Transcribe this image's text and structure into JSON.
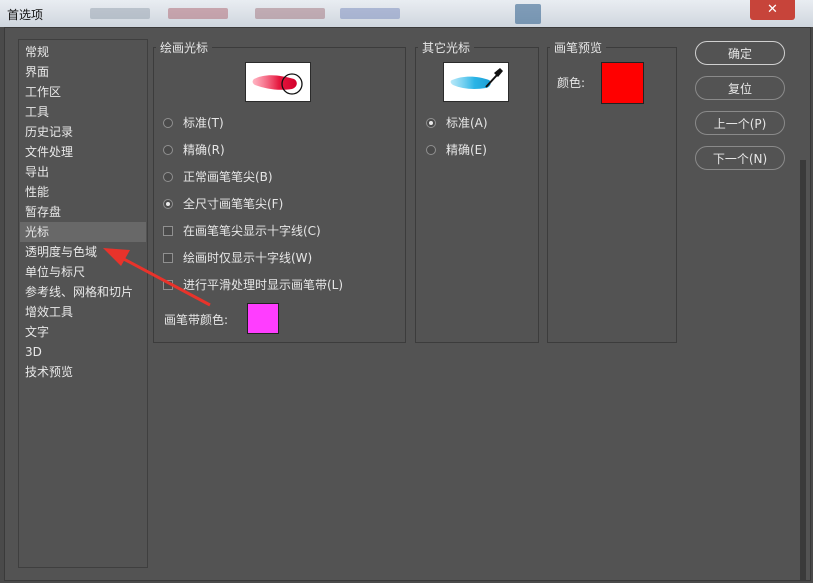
{
  "window": {
    "title": "首选项",
    "close_label": "✕"
  },
  "colors": {
    "stroke_color": "#ff3dff",
    "brush_preview_color": "#ff0000",
    "annotation_arrow": "#e8332b"
  },
  "categories": [
    {
      "label": "常规"
    },
    {
      "label": "界面"
    },
    {
      "label": "工作区"
    },
    {
      "label": "工具"
    },
    {
      "label": "历史记录"
    },
    {
      "label": "文件处理"
    },
    {
      "label": "导出"
    },
    {
      "label": "性能"
    },
    {
      "label": "暂存盘"
    },
    {
      "label": "光标"
    },
    {
      "label": "透明度与色域"
    },
    {
      "label": "单位与标尺"
    },
    {
      "label": "参考线、网格和切片"
    },
    {
      "label": "增效工具"
    },
    {
      "label": "文字"
    },
    {
      "label": "3D"
    },
    {
      "label": "技术预览"
    }
  ],
  "selected_category": "光标",
  "painting_cursors": {
    "title": "绘画光标",
    "options": [
      {
        "label": "标准(T)",
        "checked": false
      },
      {
        "label": "精确(R)",
        "checked": false
      },
      {
        "label": "正常画笔笔尖(B)",
        "checked": false
      },
      {
        "label": "全尺寸画笔笔尖(F)",
        "checked": true
      }
    ],
    "checkboxes": [
      {
        "label": "在画笔笔尖显示十字线(C)",
        "checked": false
      },
      {
        "label": "绘画时仅显示十字线(W)",
        "checked": false
      },
      {
        "label": "进行平滑处理时显示画笔带(L)",
        "checked": false
      }
    ],
    "stroke_color_label": "画笔带颜色:"
  },
  "other_cursors": {
    "title": "其它光标",
    "options": [
      {
        "label": "标准(A)",
        "checked": true
      },
      {
        "label": "精确(E)",
        "checked": false
      }
    ]
  },
  "brush_preview": {
    "title": "画笔预览",
    "color_label": "颜色:"
  },
  "buttons": {
    "ok": "确定",
    "reset": "复位",
    "prev": "上一个(P)",
    "next": "下一个(N)"
  }
}
